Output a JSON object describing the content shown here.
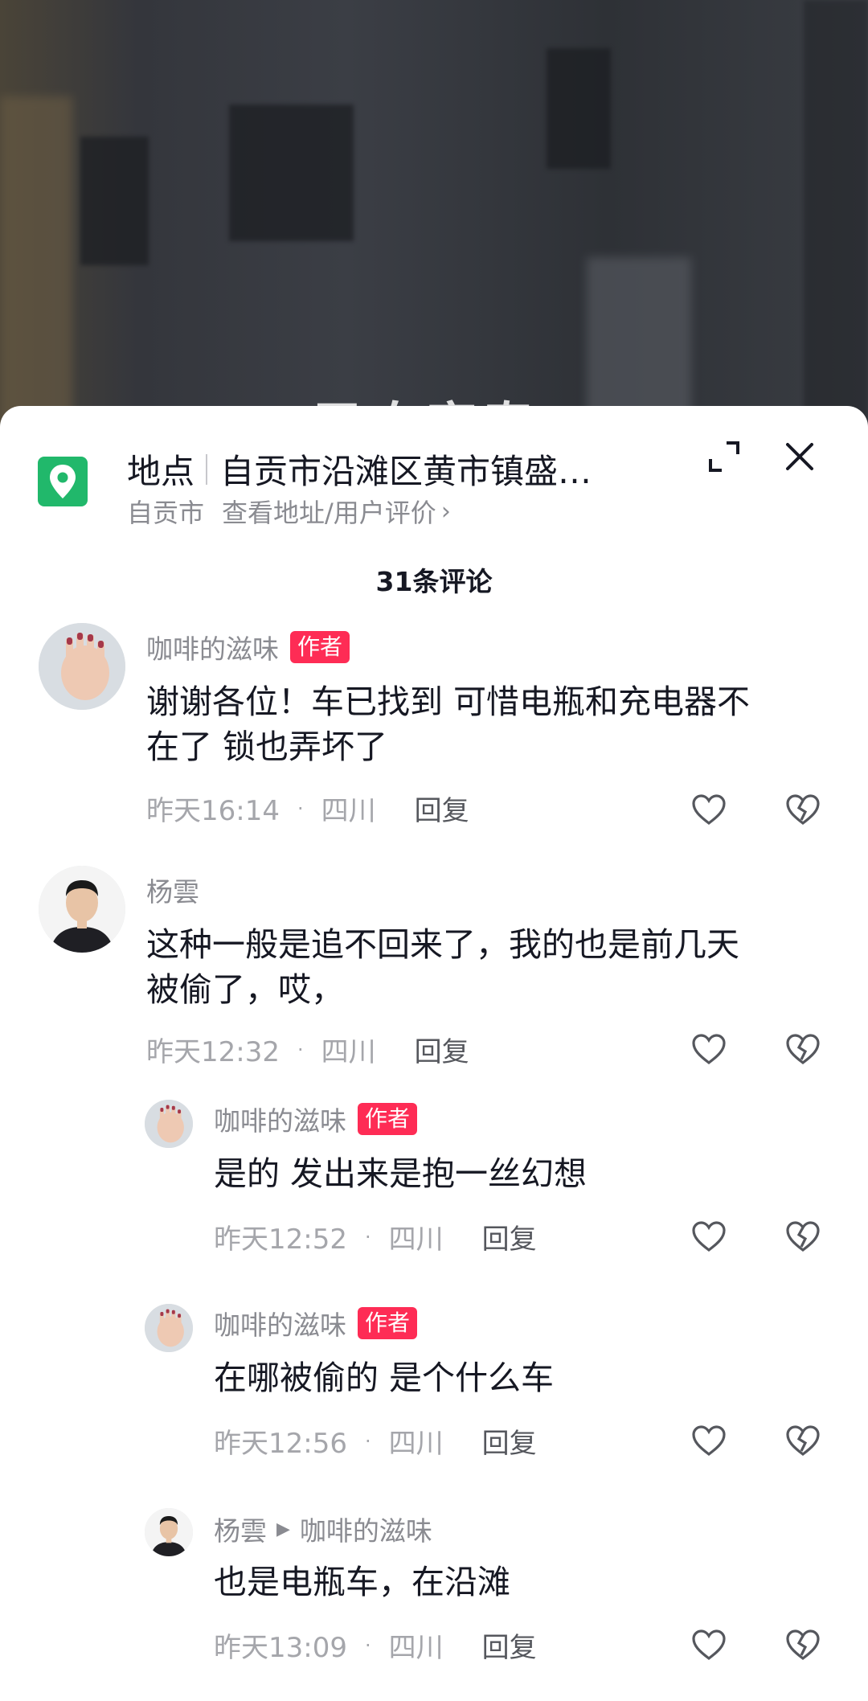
{
  "video": {
    "overlay_text": "已自家寿"
  },
  "location": {
    "label": "地点",
    "name": "自贡市沿滩区黄市镇盛…",
    "city": "自贡市",
    "link": "查看地址/用户评价"
  },
  "comments_header": "31条评论",
  "colors": {
    "accent": "#fe2c55",
    "location_green": "#21b86b"
  },
  "comments": [
    {
      "user": "咖啡的滋味",
      "badge": "作者",
      "text_line1": "谢谢各位！车已找到 可惜电瓶和充电器不",
      "text_line2": "在了 锁也弄坏了",
      "time": "昨天16:14",
      "region": "四川",
      "reply_label": "回复"
    },
    {
      "user": "杨雲",
      "text_line1": "这种一般是追不回来了，我的也是前几天",
      "text_line2": "被偷了，哎，",
      "time": "昨天12:32",
      "region": "四川",
      "reply_label": "回复"
    },
    {
      "user": "咖啡的滋味",
      "badge": "作者",
      "text_line1": "是的 发出来是抱一丝幻想",
      "time": "昨天12:52",
      "region": "四川",
      "reply_label": "回复"
    },
    {
      "user": "咖啡的滋味",
      "badge": "作者",
      "text_line1": "在哪被偷的 是个什么车",
      "time": "昨天12:56",
      "region": "四川",
      "reply_label": "回复"
    },
    {
      "user": "杨雲",
      "reply_to": "咖啡的滋味",
      "text_line1": "也是电瓶车，在沿滩",
      "time": "昨天13:09",
      "region": "四川",
      "reply_label": "回复"
    }
  ]
}
